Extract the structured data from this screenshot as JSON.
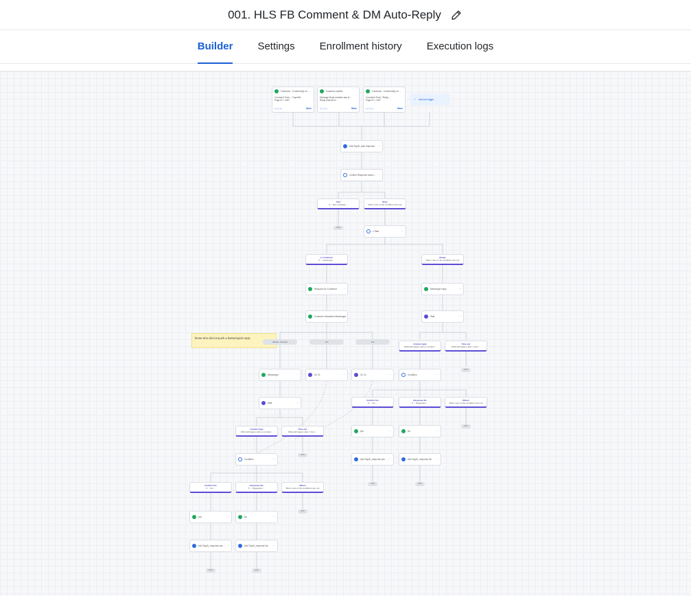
{
  "header": {
    "title": "001. HLS FB Comment & DM Auto-Reply",
    "edit_icon": "pencil-icon"
  },
  "tabs": [
    {
      "label": "Builder",
      "active": true
    },
    {
      "label": "Settings",
      "active": false
    },
    {
      "label": "Enrollment history",
      "active": false
    },
    {
      "label": "Execution logs",
      "active": false
    }
  ],
  "workflow": {
    "triggers": [
      {
        "title": "Facebook - Comment(s) on ...",
        "line1": "Comment From -- Tuyenthi",
        "line2": "Page ID = 1187",
        "store": "Store"
      },
      {
        "title": "Customer replied",
        "line1": "Message Body contains any of ...",
        "line2": "Reply channel is ...",
        "store": "Store"
      },
      {
        "title": "Facebook - Comment(s) on ...",
        "line1": "Comment From / Reply ...",
        "line2": "Page ID = 1187",
        "store": "Store"
      }
    ],
    "add_trigger": "Add new trigger",
    "note": "those who did not push a button/quick reply",
    "end_label": "END",
    "nodes": {
      "add_tag": "Add Tag fb_auto response",
      "custom_code": "Custom Response action ...",
      "text_branch": "Text",
      "text_sub": "If ... last_message ...",
      "none_branch": "None",
      "none_sub": "When none of the conditions are met",
      "first_chat": "1 Start",
      "is_comment": "Is Comment",
      "is_comment_sub": "If ... messenger ...",
      "empty": "Empty",
      "empty_sub": "When none of the conditions are met",
      "respond_comment": "Respond On Comment",
      "send_messenger": "Customer Interaction Messenger",
      "messenger_reply": "Messenger reply",
      "wait": "Wait",
      "contact_reply": "Contact reply",
      "contact_reply_sub": "What will happen when a contact...",
      "time_out": "Time out",
      "time_out_sub": "What will happen after 1 hour ...",
      "messenger": "Messenger",
      "go_to": "Go To",
      "condition": "Condition",
      "confirm_yes": "Confirm Yes",
      "confirm_yes_sub": "If ... Yes ...",
      "response_no": "Response No",
      "response_no_sub": "If ... Suggestion ...",
      "others": "Others",
      "others_sub": "When none of the conditions are met",
      "yes": "yes",
      "no": "No",
      "add_tag_yes": "Add Tag fb_response yes",
      "add_tag_no": "Add Tag fb_response No"
    },
    "pills": [
      "default / Session",
      "Yes",
      "Yes"
    ]
  },
  "colors": {
    "accent": "#1a5fd6",
    "branch": "#5b4bd6",
    "green": "#1fa85c",
    "note": "#fdf3bf"
  }
}
